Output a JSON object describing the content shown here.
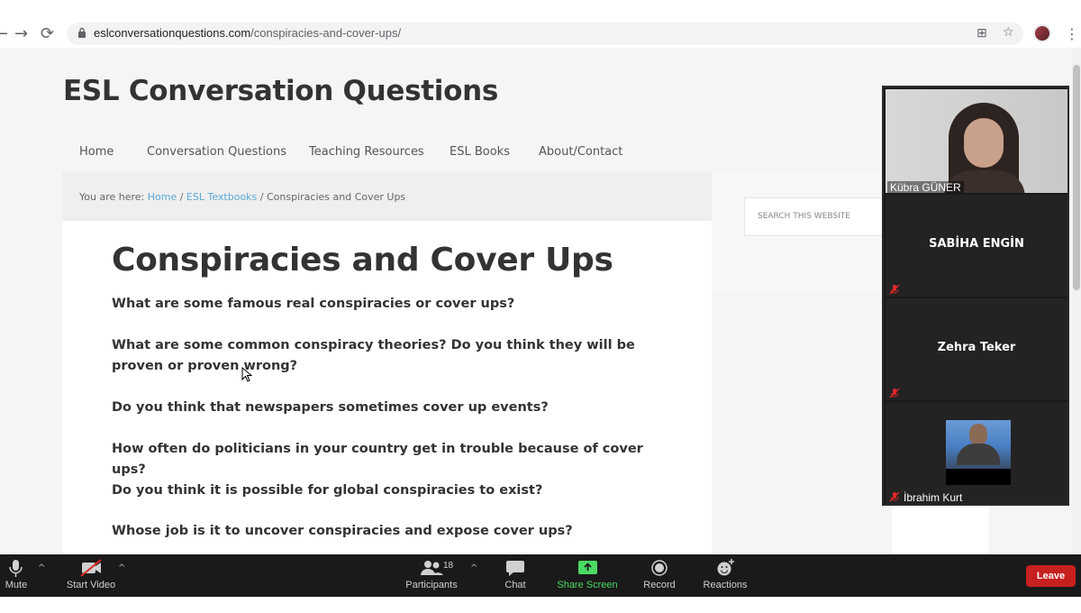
{
  "browser": {
    "url_domain": "eslconversationquestions.com",
    "url_path": "/conspiracies-and-cover-ups/",
    "back_icon": "←",
    "forward_icon": "→",
    "reload_icon": "⟳",
    "translate_icon": "⊞",
    "star_icon": "☆",
    "menu_icon": "⋮"
  },
  "site": {
    "title": "ESL Conversation Questions",
    "nav": [
      "Home",
      "Conversation Questions",
      "Teaching Resources",
      "ESL Books",
      "About/Contact"
    ],
    "breadcrumb": {
      "prefix": "You are here: ",
      "links": [
        "Home",
        "ESL Textbooks"
      ],
      "separator": " / ",
      "current": "Conspiracies and Cover Ups"
    },
    "search_placeholder": "SEARCH THIS WEBSITE",
    "article_title": "Conspiracies and Cover Ups",
    "questions": [
      "What are some famous real conspiracies or cover ups?",
      "What are some common conspiracy theories? Do you think they will be proven or proven wrong?",
      "Do you think that newspapers sometimes cover up events?",
      "How often do politicians in your country get in trouble because of cover ups?",
      "Do you think it is possible for global conspiracies to exist?",
      "Whose job is it to uncover conspiracies and expose cover ups?"
    ]
  },
  "zoom": {
    "participants": [
      {
        "name": "Kübra GÜNER",
        "video": true
      },
      {
        "name": "SABİHA ENGİN",
        "video": false
      },
      {
        "name": "Zehra Teker",
        "video": false
      },
      {
        "name": "İbrahim Kurt",
        "video": true
      }
    ],
    "toolbar": {
      "mute": "Mute",
      "start_video": "Start Video",
      "participants": "Participants",
      "participants_count": "18",
      "chat": "Chat",
      "share_screen": "Share Screen",
      "record": "Record",
      "reactions": "Reactions",
      "leave": "Leave"
    },
    "colors": {
      "share_green": "#4cd964",
      "leave_red": "#c6201f",
      "mic_off_red": "#e02828"
    }
  }
}
